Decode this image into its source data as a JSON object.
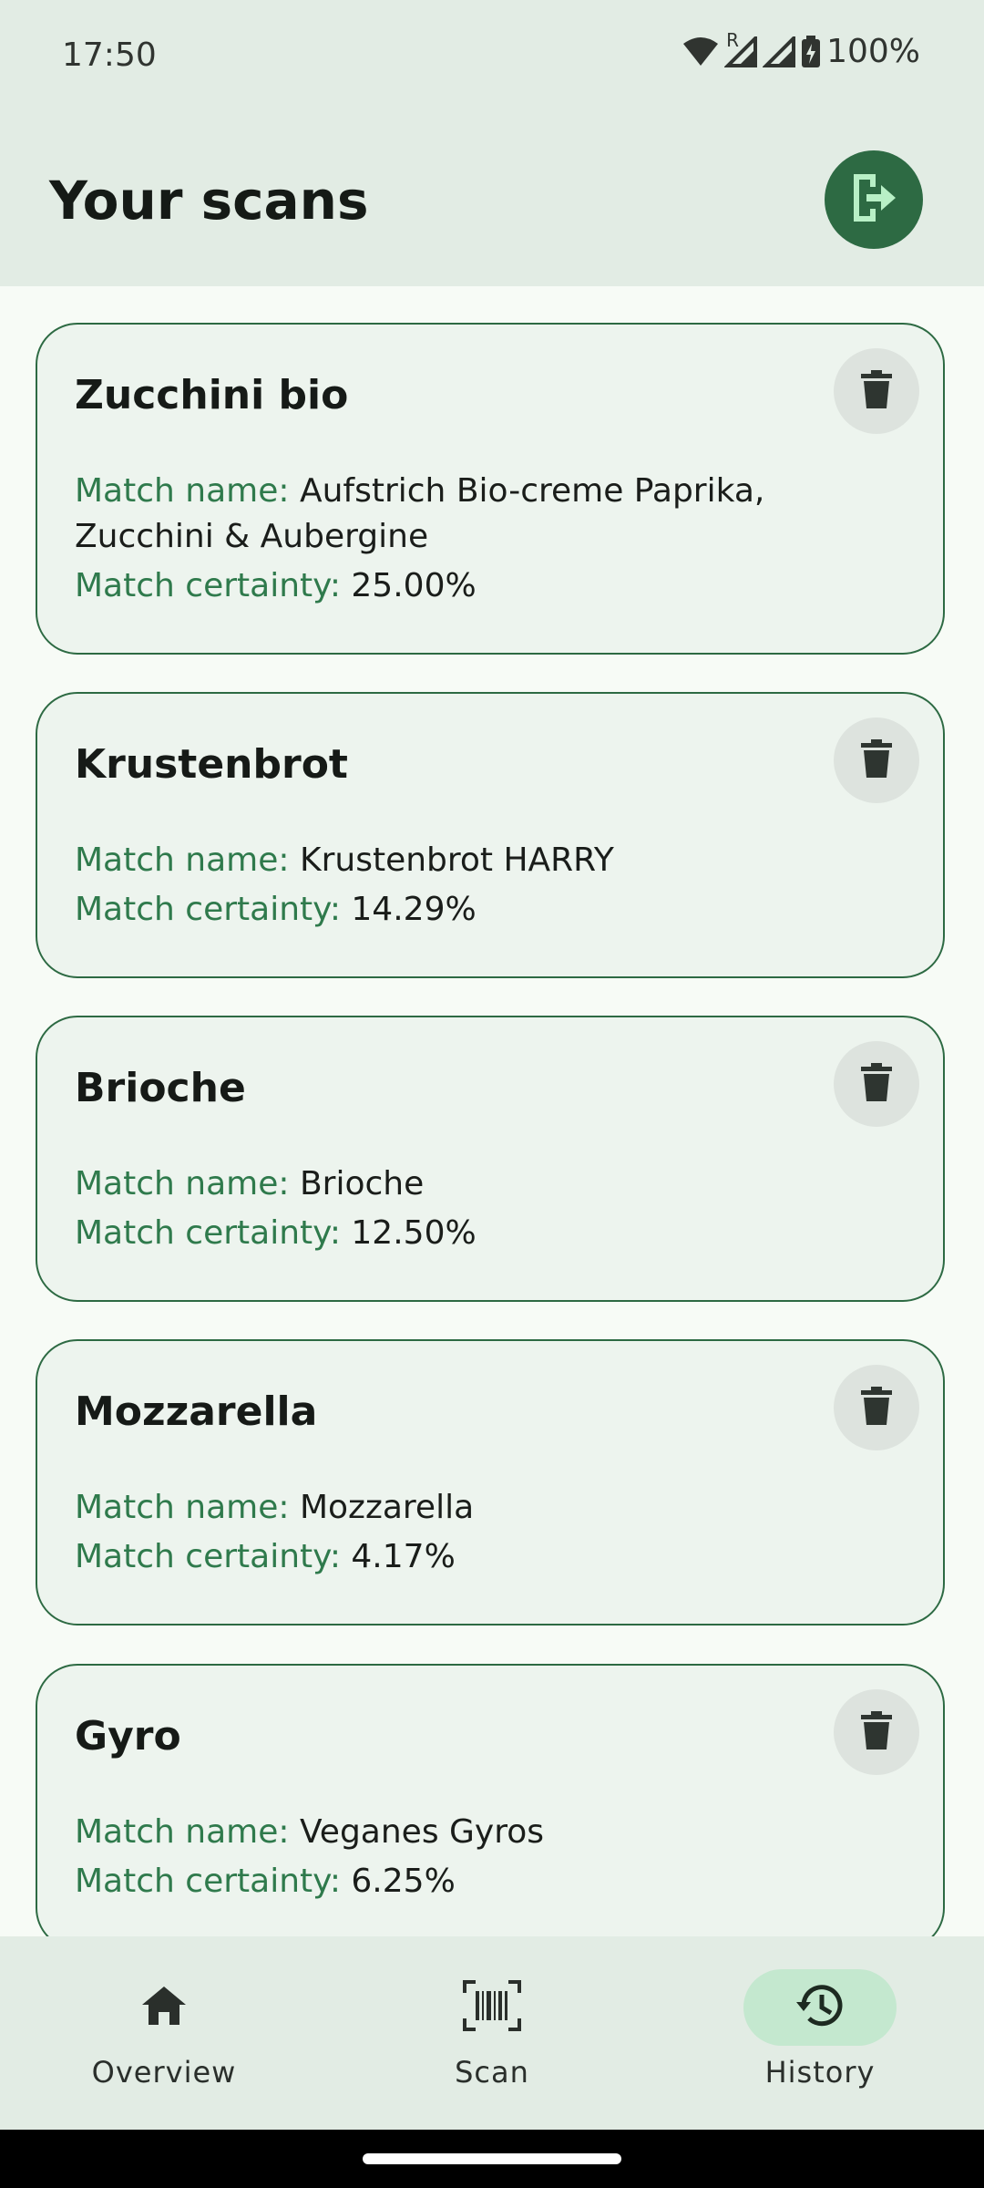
{
  "status_bar": {
    "time": "17:50",
    "roaming_indicator": "R",
    "battery_percent": "100%",
    "icons": [
      "wifi-icon",
      "signal-icon",
      "signal-icon",
      "battery-charging-icon"
    ]
  },
  "app_bar": {
    "title": "Your scans",
    "action_icon": "logout-icon"
  },
  "scans": [
    {
      "title": "Zucchini bio",
      "match_name_label": "Match name: ",
      "match_name": "Aufstrich Bio-creme Paprika, Zucchini & Aubergine",
      "match_certainty_label": "Match certainty: ",
      "match_certainty": "25.00%"
    },
    {
      "title": "Krustenbrot",
      "match_name_label": "Match name: ",
      "match_name": "Krustenbrot HARRY",
      "match_certainty_label": "Match certainty: ",
      "match_certainty": "14.29%"
    },
    {
      "title": "Brioche",
      "match_name_label": "Match name: ",
      "match_name": "Brioche",
      "match_certainty_label": "Match certainty: ",
      "match_certainty": "12.50%"
    },
    {
      "title": "Mozzarella",
      "match_name_label": "Match name: ",
      "match_name": "Mozzarella",
      "match_certainty_label": "Match certainty: ",
      "match_certainty": "4.17%"
    },
    {
      "title": "Gyro",
      "match_name_label": "Match name: ",
      "match_name": "Veganes Gyros",
      "match_certainty_label": "Match certainty: ",
      "match_certainty": "6.25%"
    }
  ],
  "nav": {
    "items": [
      {
        "label": "Overview",
        "icon": "home-icon",
        "active": false
      },
      {
        "label": "Scan",
        "icon": "barcode-scan-icon",
        "active": false
      },
      {
        "label": "History",
        "icon": "history-icon",
        "active": true
      }
    ]
  },
  "colors": {
    "accent": "#2D6A43",
    "label_green": "#2F7A4C",
    "card_background": "#EDF4EE",
    "app_bar_background": "#E2ECE4",
    "active_nav_pill": "#C4E8CF"
  }
}
